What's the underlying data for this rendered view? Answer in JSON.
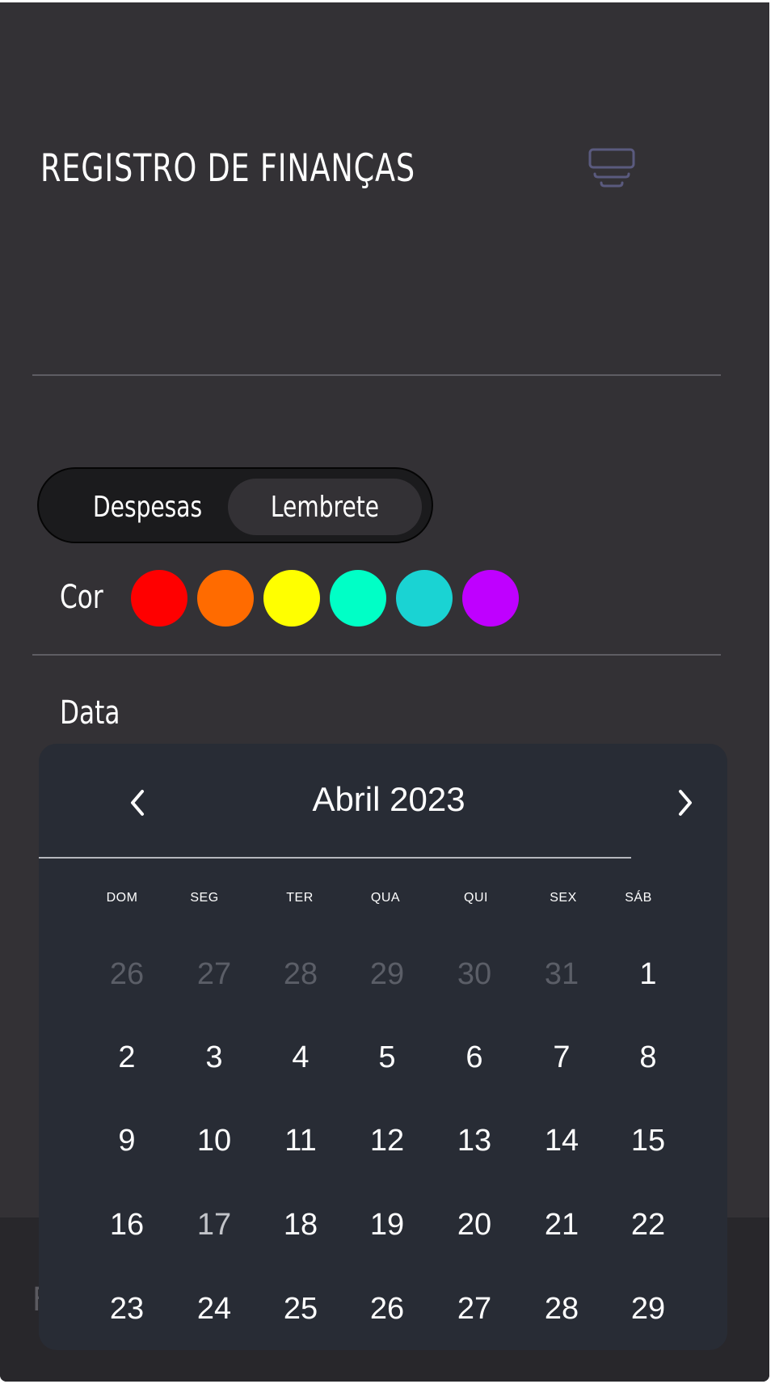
{
  "app": {
    "title": "REGISTRO DE FINANÇAS",
    "menu_icon": "menu-icon"
  },
  "toggle": {
    "options": [
      "Despesas",
      "Lembrete"
    ],
    "selected": "Lembrete"
  },
  "color_section": {
    "label": "Cor",
    "swatches": [
      "#ff0000",
      "#ff6b00",
      "#ffff00",
      "#00ffc6",
      "#1ad3d3",
      "#bf00ff"
    ]
  },
  "date_section": {
    "label": "Data"
  },
  "bottom_field": {
    "label_fragment": "F"
  },
  "calendar": {
    "month_label": "Abril 2023",
    "prev_icon": "chevron-left-icon",
    "next_icon": "chevron-right-icon",
    "weekdays": [
      "DOM",
      "SEG",
      "TER",
      "QUA",
      "QUI",
      "SEX",
      "SÁB"
    ],
    "weeks": [
      [
        "26",
        "27",
        "28",
        "29",
        "30",
        "31",
        "1"
      ],
      [
        "2",
        "3",
        "4",
        "5",
        "6",
        "7",
        "8"
      ],
      [
        "9",
        "10",
        "11",
        "12",
        "13",
        "14",
        "15"
      ],
      [
        "16",
        "17",
        "18",
        "19",
        "20",
        "21",
        "22"
      ],
      [
        "23",
        "24",
        "25",
        "26",
        "27",
        "28",
        "29"
      ]
    ],
    "previous_month_days_in_first_week": 6,
    "highlighted_day": "17"
  }
}
